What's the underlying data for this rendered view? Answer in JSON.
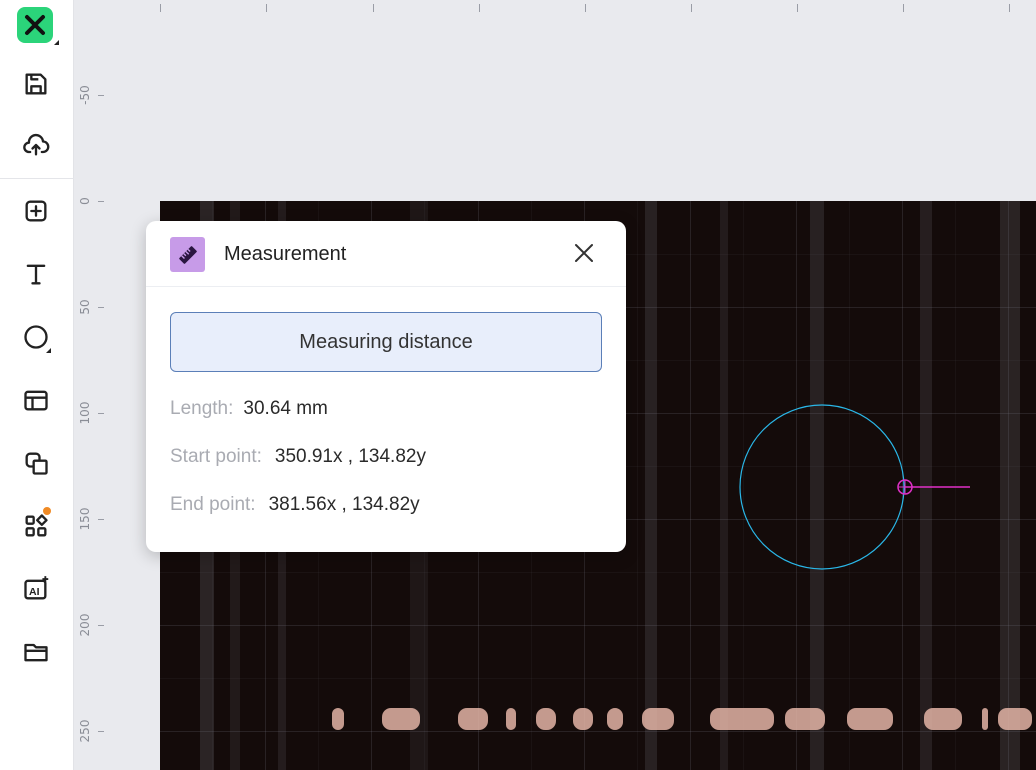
{
  "sidebar": {
    "tools": [
      {
        "name": "save",
        "icon": "save-icon"
      },
      {
        "name": "upload",
        "icon": "cloud-upload-icon"
      },
      {
        "name": "add",
        "icon": "plus-square-icon"
      },
      {
        "name": "text",
        "icon": "text-icon"
      },
      {
        "name": "shape",
        "icon": "circle-icon"
      },
      {
        "name": "layout",
        "icon": "layout-icon"
      },
      {
        "name": "elements",
        "icon": "elements-icon"
      },
      {
        "name": "apps",
        "icon": "apps-icon"
      },
      {
        "name": "ai",
        "icon": "ai-icon"
      },
      {
        "name": "files",
        "icon": "folder-icon"
      }
    ],
    "ai_label": "AI",
    "accent": "#2bd47a",
    "notification_color": "#f08a24"
  },
  "ruler": {
    "left_labels": [
      "-50",
      "0",
      "50",
      "100",
      "150",
      "200",
      "250"
    ]
  },
  "measurement": {
    "title": "Measurement",
    "mode_label": "Measuring distance",
    "length_label": "Length:",
    "length_value": "30.64 mm",
    "start_label": "Start point:",
    "start_value": "350.91x , 134.82y",
    "end_label": "End point:",
    "end_value": "381.56x , 134.82y",
    "icon_color": "#c79be8"
  },
  "overlay": {
    "circle_color": "#2ab7e8",
    "line_color": "#e030c8"
  }
}
